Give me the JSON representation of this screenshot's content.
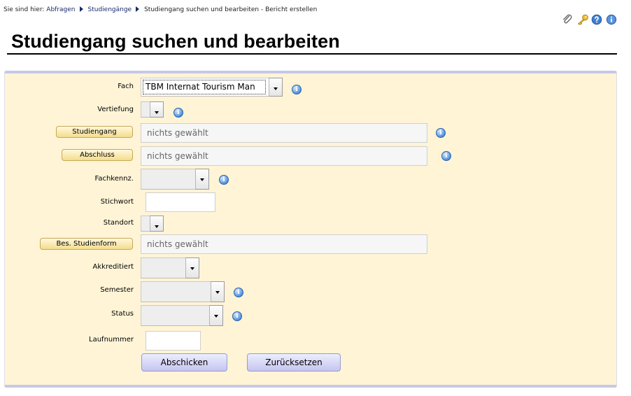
{
  "breadcrumb": {
    "prefix": "Sie sind hier:",
    "items": [
      "Abfragen",
      "Studiengänge"
    ],
    "current": "Studiengang suchen und bearbeiten - Bericht erstellen"
  },
  "top_icons": [
    "paperclip-icon",
    "key-icon",
    "help-icon",
    "info-icon"
  ],
  "page_title": "Studiengang suchen und bearbeiten",
  "colors": {
    "panel_bg": "#fff4d6",
    "panel_border": "#c7c8e6",
    "link": "#1a2a6a"
  },
  "form": {
    "fach": {
      "label": "Fach",
      "value": "TBM Internat Tourism Man"
    },
    "vertiefung": {
      "label": "Vertiefung",
      "value": ""
    },
    "studiengang": {
      "button": "Studiengang",
      "value": "nichts gewählt"
    },
    "abschluss": {
      "button": "Abschluss",
      "value": "nichts gewählt"
    },
    "fachkennz": {
      "label": "Fachkennz.",
      "value": ""
    },
    "stichwort": {
      "label": "Stichwort",
      "value": ""
    },
    "standort": {
      "label": "Standort",
      "value": ""
    },
    "studienform": {
      "button": "Bes. Studienform",
      "value": "nichts gewählt"
    },
    "akkreditiert": {
      "label": "Akkreditiert",
      "value": ""
    },
    "semester": {
      "label": "Semester",
      "value": ""
    },
    "status": {
      "label": "Status",
      "value": ""
    },
    "laufnummer": {
      "label": "Laufnummer",
      "value": ""
    },
    "submit": "Abschicken",
    "reset": "Zurücksetzen"
  }
}
